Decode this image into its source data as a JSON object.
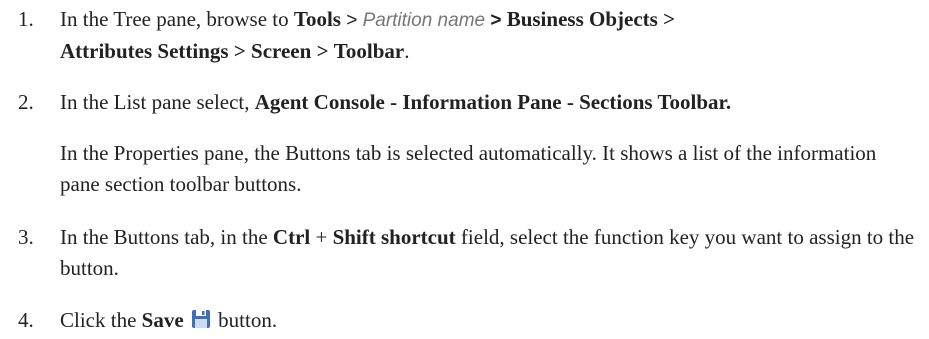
{
  "steps": [
    {
      "num": "1.",
      "lead": "In the Tree pane, browse to ",
      "tools": "Tools",
      "sep": ">",
      "partition": "Partition name",
      "business_objects": "Business Objects",
      "attributes_settings": "Attributes Settings",
      "screen": "Screen",
      "toolbar": "Toolbar",
      "period": "."
    },
    {
      "num": "2.",
      "lead": "In the List pane select, ",
      "bold": "Agent Console - Information Pane - Sections Toolbar.",
      "note": "In the Properties pane, the Buttons tab is selected automatically. It shows a list of the information pane section toolbar buttons."
    },
    {
      "num": "3.",
      "lead": "In the Buttons tab, in the ",
      "ctrl": "Ctrl",
      "plus": "+",
      "shift": "Shift shortcut",
      "trail": " field, select the function key you want to assign to the button."
    },
    {
      "num": "4.",
      "lead": "Click the ",
      "save": "Save",
      "trail": " button.",
      "icon": "save-icon"
    }
  ],
  "colors": {
    "text": "#222222",
    "placeholder": "#777777",
    "icon": "#3f6fb5"
  }
}
